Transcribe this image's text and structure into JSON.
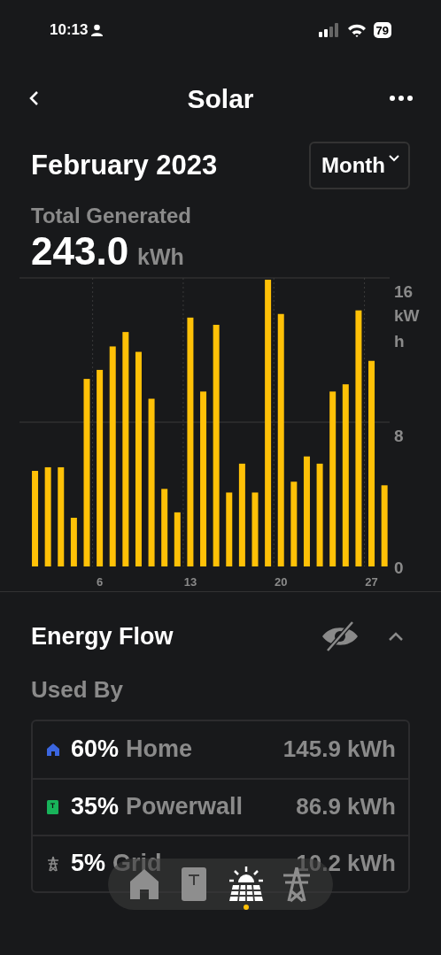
{
  "status_bar": {
    "time": "10:13",
    "battery": "79"
  },
  "header": {
    "title": "Solar"
  },
  "period": {
    "title": "February 2023",
    "selector": "Month"
  },
  "summary": {
    "label": "Total Generated",
    "value": "243.0",
    "unit": "kWh"
  },
  "chart_data": {
    "type": "bar",
    "ylabel": "kWh",
    "x": [
      1,
      2,
      3,
      4,
      5,
      6,
      7,
      8,
      9,
      10,
      11,
      12,
      13,
      14,
      15,
      16,
      17,
      18,
      19,
      20,
      21,
      22,
      23,
      24,
      25,
      26,
      27,
      28
    ],
    "series": [
      {
        "color": "#ffc107",
        "values": [
          5.3,
          5.5,
          5.5,
          2.7,
          10.4,
          10.9,
          12.2,
          13.0,
          11.9,
          9.3,
          4.3,
          3.0,
          13.8,
          9.7,
          13.4,
          4.1,
          5.7,
          4.1,
          15.9,
          14.0,
          4.7,
          6.1,
          5.7,
          9.7,
          10.1,
          14.2,
          11.4,
          4.5
        ]
      }
    ],
    "xlim": [
      -0.2,
      28.4
    ],
    "ylim": [
      0,
      16
    ],
    "xticks": [
      6,
      13,
      20,
      27
    ],
    "yticks": [
      0,
      8,
      16
    ]
  },
  "energy_flow": {
    "title": "Energy Flow",
    "subtitle": "Used By",
    "expanded": true,
    "rows": [
      {
        "kind": "home",
        "percent": "60%",
        "label": "Home",
        "amount": "145.9 kWh",
        "color": "#3b66e0"
      },
      {
        "kind": "powerwall",
        "percent": "35%",
        "label": "Powerwall",
        "amount": "86.9 kWh",
        "color": "#18b35a"
      },
      {
        "kind": "grid",
        "percent": "5%",
        "label": "Grid",
        "amount": "10.2 kWh",
        "color": "#8a8a8a"
      }
    ]
  },
  "nav": [
    {
      "kind": "home",
      "selected": false
    },
    {
      "kind": "powerwall",
      "selected": false
    },
    {
      "kind": "solar",
      "selected": true
    },
    {
      "kind": "grid",
      "selected": false
    }
  ]
}
